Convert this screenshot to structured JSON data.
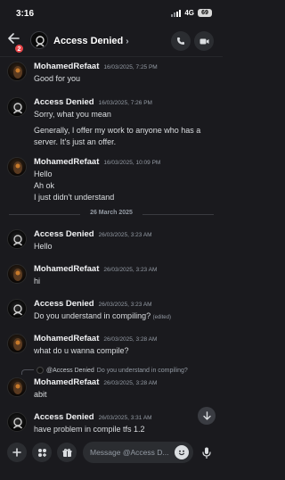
{
  "status_bar": {
    "time": "3:16",
    "network": "4G",
    "battery": "69"
  },
  "header": {
    "unread_badge": "2",
    "channel_name": "Access Denied",
    "chevron": "›"
  },
  "icons": {
    "back": "arrow-left-icon",
    "call": "phone-icon",
    "video": "video-camera-icon",
    "plus": "plus-icon",
    "apps": "apps-icon",
    "gift": "gift-icon",
    "emoji": "emoji-icon",
    "mic": "microphone-icon",
    "scroll_down": "arrow-down-icon"
  },
  "messages": [
    {
      "user": "MohamedRefaat",
      "time": "16/03/2025, 7:25 PM",
      "lines": [
        "Good for you"
      ]
    },
    {
      "user": "Access Denied",
      "time": "16/03/2025, 7:26 PM",
      "lines": [
        "Sorry, what you mean",
        "Generally, I offer my work to anyone who has a server. It's just an offer."
      ]
    },
    {
      "user": "MohamedRefaat",
      "time": "16/03/2025, 10:09 PM",
      "lines": [
        "Hello",
        "Ah ok",
        "I just didn't understand"
      ]
    },
    {
      "user": "Access Denied",
      "time": "26/03/2025, 3:23 AM",
      "lines": [
        "Hello"
      ]
    },
    {
      "user": "MohamedRefaat",
      "time": "26/03/2025, 3:23 AM",
      "lines": [
        "hi"
      ]
    },
    {
      "user": "Access Denied",
      "time": "26/03/2025, 3:23 AM",
      "lines": [
        "Do you understand in compiling?"
      ],
      "edited": "(edited)"
    },
    {
      "user": "MohamedRefaat",
      "time": "26/03/2025, 3:28 AM",
      "lines": [
        "what do u wanna compile?"
      ]
    },
    {
      "user": "MohamedRefaat",
      "time": "26/03/2025, 3:28 AM",
      "lines": [
        "abit"
      ],
      "reply": {
        "user": "@Access Denied",
        "text": "Do you understand in compiling?"
      }
    },
    {
      "user": "Access Denied",
      "time": "26/03/2025, 3:31 AM",
      "lines": [
        "have problem in compile tfs 1.2"
      ]
    }
  ],
  "date_separator": "26 March 2025",
  "composer": {
    "placeholder": "Message @Access D..."
  }
}
